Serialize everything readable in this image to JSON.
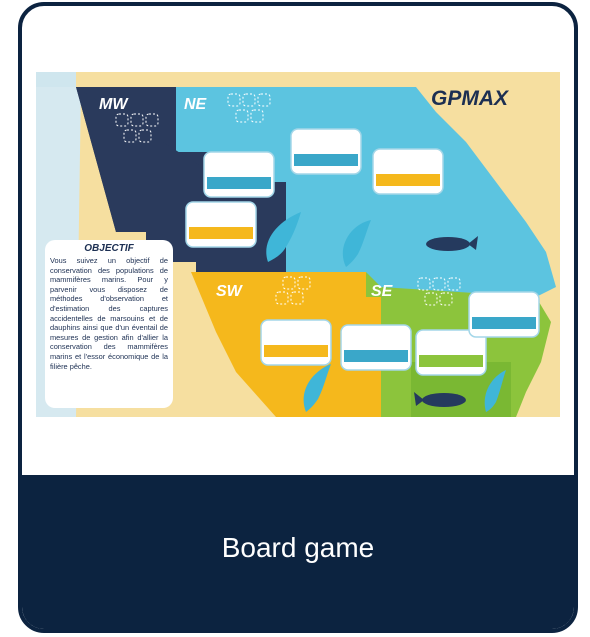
{
  "card": {
    "footer_title": "Board game"
  },
  "board": {
    "logo_text": "GPMAX",
    "zones": {
      "mw": "MW",
      "ne": "NE",
      "sw": "SW",
      "se": "SE"
    },
    "objective": {
      "title": "OBJECTIF",
      "text": "Vous suivez un objectif de conservation des populations de mammifères marins. Pour y parvenir vous disposez de méthodes d'observation et d'estimation des captures accidentelles de marsouins et de dauphins ainsi que d'un éventail de mesures de gestion afin d'allier la conservation des mammifères marins et l'essor économique de la filière pêche."
    },
    "colors": {
      "sea_ne": "#5cc4e0",
      "sea_mw": "#2a3a5c",
      "sea_sw": "#f5b81c",
      "sea_se": "#8cc43c",
      "land": "#f6dfa0",
      "dolphin": "#3fb6d8",
      "porpoise": "#253a5e",
      "card_border": "#0c2340"
    }
  }
}
